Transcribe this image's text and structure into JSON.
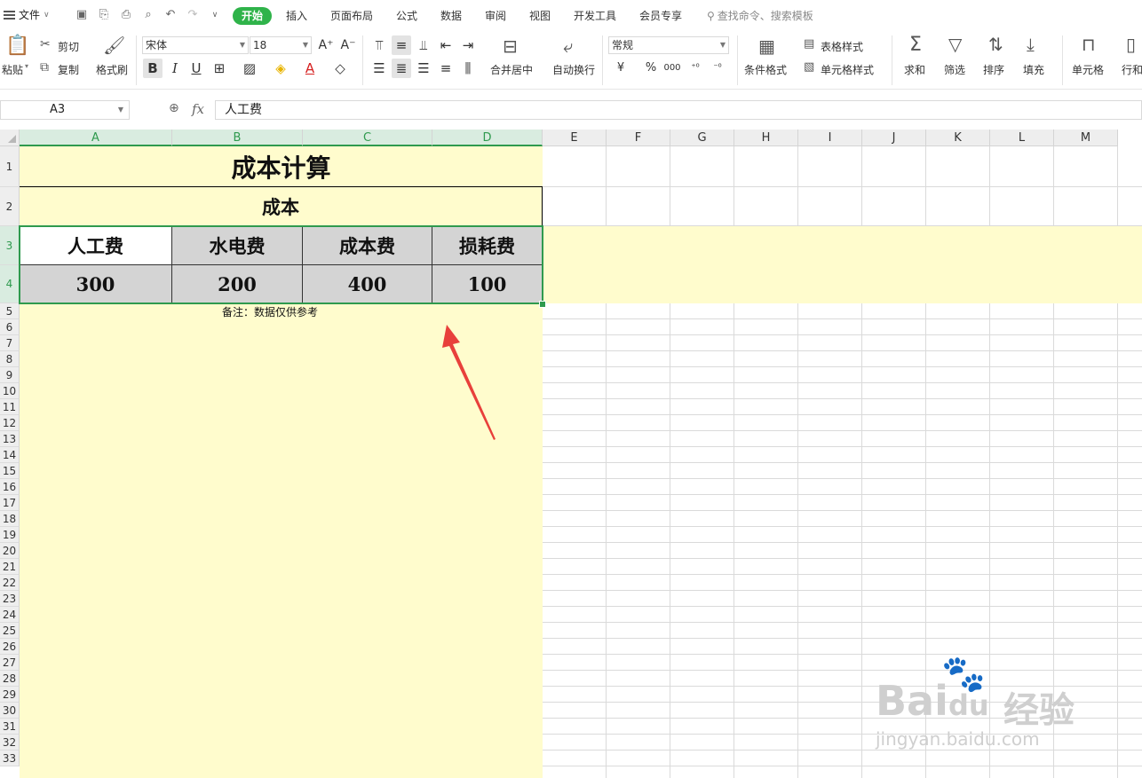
{
  "menubar": {
    "file": "文件",
    "tabs": [
      "插入",
      "页面布局",
      "公式",
      "数据",
      "审阅",
      "视图",
      "开发工具",
      "会员专享"
    ],
    "active_tab": "开始",
    "search_placeholder": "查找命令、搜索模板"
  },
  "ribbon": {
    "paste": "粘贴",
    "cut": "剪切",
    "copy": "复制",
    "format_painter": "格式刷",
    "font_name": "宋体",
    "font_size": "18",
    "merge_center": "合并居中",
    "wrap_text": "自动换行",
    "number_format": "常规",
    "conditional_format": "条件格式",
    "table_style": "表格样式",
    "cell_style": "单元格样式",
    "sum": "求和",
    "filter": "筛选",
    "sort": "排序",
    "fill": "填充",
    "cell": "单元格",
    "rows_cols": "行和",
    "currency_symbol": "¥",
    "percent_symbol": "%",
    "thousands_symbol": "000"
  },
  "formula_bar": {
    "name_box": "A3",
    "fx": "fx",
    "content": "人工费"
  },
  "columns": [
    "A",
    "B",
    "C",
    "D",
    "E",
    "F",
    "G",
    "H",
    "I",
    "J",
    "K",
    "L",
    "M"
  ],
  "rows": [
    "1",
    "2",
    "3",
    "4",
    "5",
    "6",
    "7",
    "8",
    "9",
    "10",
    "11",
    "12",
    "13",
    "14",
    "15",
    "16",
    "17",
    "18",
    "19",
    "20",
    "21",
    "22",
    "23",
    "24",
    "25",
    "26",
    "27",
    "28",
    "29",
    "30",
    "31",
    "32",
    "33"
  ],
  "sheet": {
    "title": "成本计算",
    "subtitle": "成本",
    "headers": [
      "人工费",
      "水电费",
      "成本费",
      "损耗费"
    ],
    "values": [
      "300",
      "200",
      "400",
      "100"
    ],
    "note": "备注：数据仅供参考"
  },
  "watermark": {
    "brand": "Bai",
    "brand2": "du",
    "cn": "经验",
    "url": "jingyan.baidu.com"
  },
  "colors": {
    "accent": "#2fb34a",
    "selection": "#2f9a4e",
    "highlight": "#fffccd",
    "arrow": "#e8403b"
  }
}
